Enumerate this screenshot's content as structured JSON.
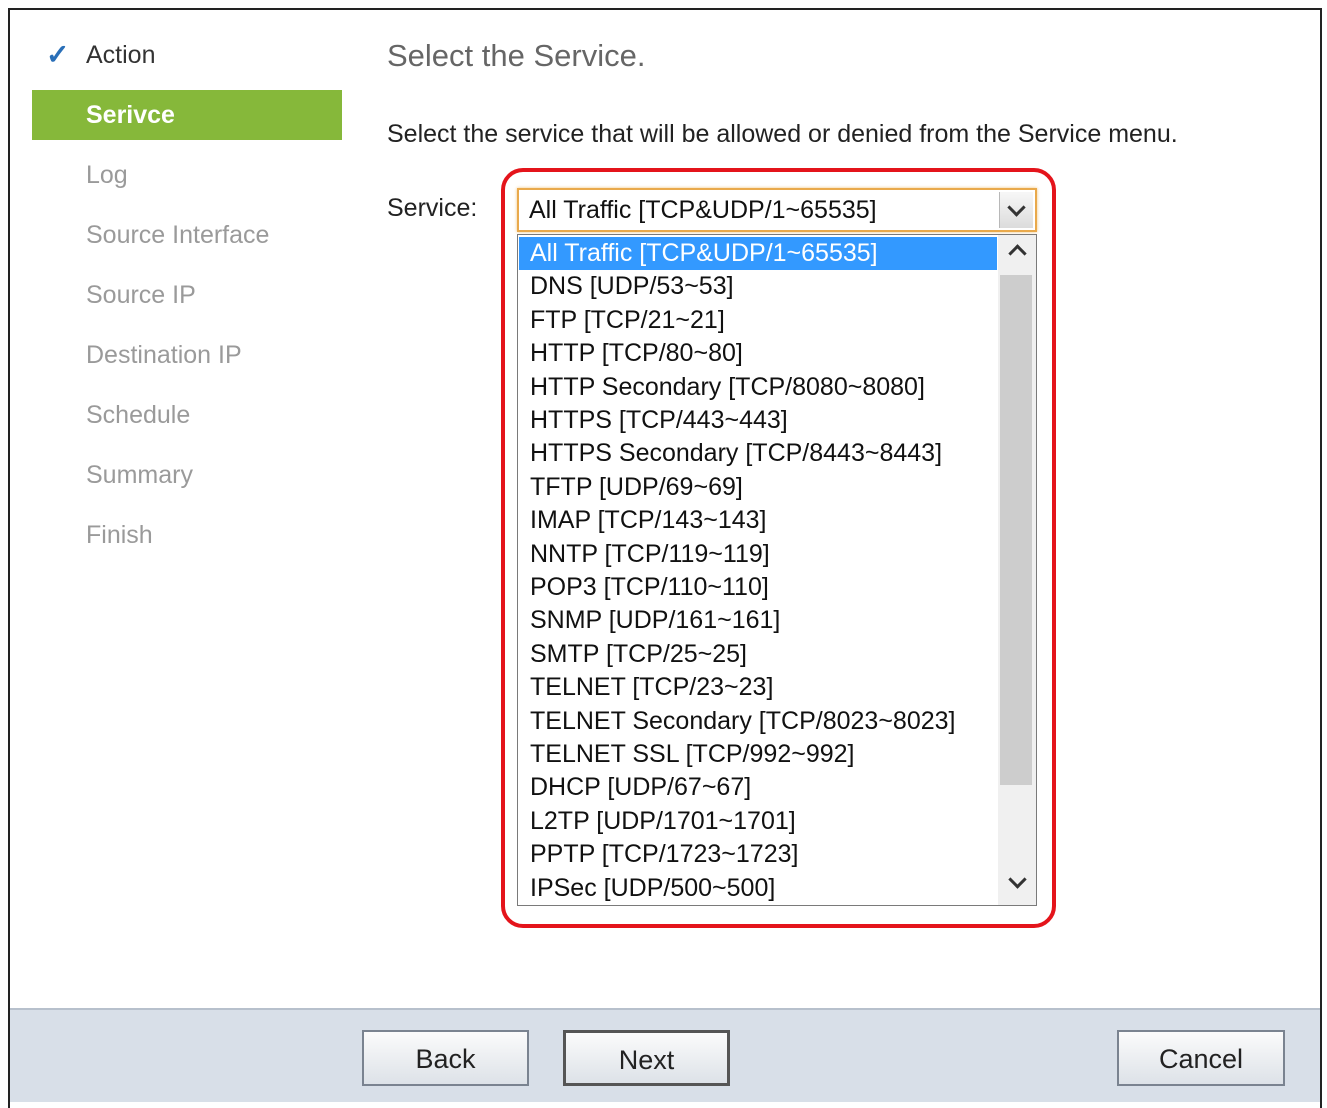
{
  "nav": {
    "items": [
      {
        "label": "Action",
        "state": "done"
      },
      {
        "label": "Serivce",
        "state": "active"
      },
      {
        "label": "Log",
        "state": "pending"
      },
      {
        "label": "Source Interface",
        "state": "pending"
      },
      {
        "label": "Source IP",
        "state": "pending"
      },
      {
        "label": "Destination IP",
        "state": "pending"
      },
      {
        "label": "Schedule",
        "state": "pending"
      },
      {
        "label": "Summary",
        "state": "pending"
      },
      {
        "label": "Finish",
        "state": "pending"
      }
    ]
  },
  "main": {
    "title": "Select the Service.",
    "instruction": "Select the service that will be allowed or denied from the Service menu.",
    "service_label": "Service:",
    "service_value": "All Traffic [TCP&UDP/1~65535]",
    "options": [
      "All Traffic [TCP&UDP/1~65535]",
      "DNS [UDP/53~53]",
      "FTP [TCP/21~21]",
      "HTTP [TCP/80~80]",
      "HTTP Secondary [TCP/8080~8080]",
      "HTTPS [TCP/443~443]",
      "HTTPS Secondary [TCP/8443~8443]",
      "TFTP [UDP/69~69]",
      "IMAP [TCP/143~143]",
      "NNTP [TCP/119~119]",
      "POP3 [TCP/110~110]",
      "SNMP [UDP/161~161]",
      "SMTP [TCP/25~25]",
      "TELNET [TCP/23~23]",
      "TELNET Secondary [TCP/8023~8023]",
      "TELNET SSL [TCP/992~992]",
      "DHCP [UDP/67~67]",
      "L2TP [UDP/1701~1701]",
      "PPTP [TCP/1723~1723]",
      "IPSec [UDP/500~500]"
    ],
    "selected_index": 0
  },
  "footer": {
    "back_label": "Back",
    "next_label": "Next",
    "cancel_label": "Cancel"
  },
  "colors": {
    "active_nav": "#86b83a",
    "check": "#2a6fb8",
    "selection": "#3399ff",
    "highlight": "#e4141b"
  }
}
